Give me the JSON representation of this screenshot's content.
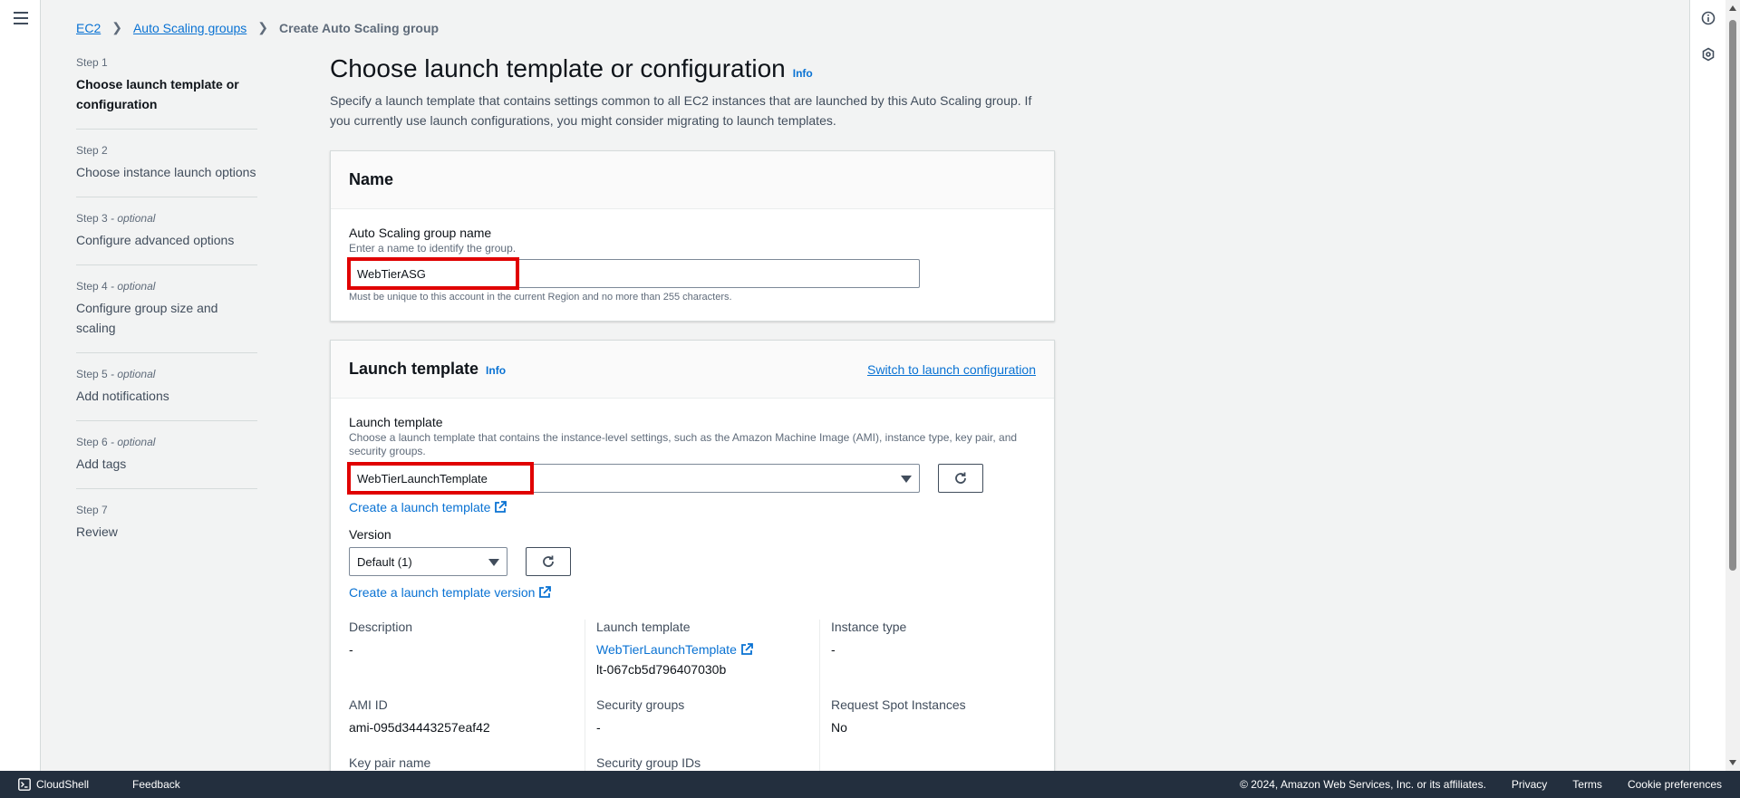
{
  "breadcrumb": {
    "items": [
      "EC2",
      "Auto Scaling groups"
    ],
    "current": "Create Auto Scaling group"
  },
  "steps": [
    {
      "num": "Step 1",
      "optional": "",
      "title": "Choose launch template or configuration"
    },
    {
      "num": "Step 2",
      "optional": "",
      "title": "Choose instance launch options"
    },
    {
      "num": "Step 3",
      "optional": " - optional",
      "title": "Configure advanced options"
    },
    {
      "num": "Step 4",
      "optional": " - optional",
      "title": "Configure group size and scaling"
    },
    {
      "num": "Step 5",
      "optional": " - optional",
      "title": "Add notifications"
    },
    {
      "num": "Step 6",
      "optional": " - optional",
      "title": "Add tags"
    },
    {
      "num": "Step 7",
      "optional": "",
      "title": "Review"
    }
  ],
  "main": {
    "title": "Choose launch template or configuration",
    "info": "Info",
    "description": "Specify a launch template that contains settings common to all EC2 instances that are launched by this Auto Scaling group. If you currently use launch configurations, you might consider migrating to launch templates."
  },
  "name_panel": {
    "header": "Name",
    "label": "Auto Scaling group name",
    "desc": "Enter a name to identify the group.",
    "value": "WebTierASG",
    "hint": "Must be unique to this account in the current Region and no more than 255 characters."
  },
  "launch_panel": {
    "header": "Launch template",
    "info": "Info",
    "switch_link": "Switch to launch configuration",
    "label": "Launch template",
    "desc": "Choose a launch template that contains the instance-level settings, such as the Amazon Machine Image (AMI), instance type, key pair, and security groups.",
    "selected": "WebTierLaunchTemplate",
    "create_link": "Create a launch template",
    "version_label": "Version",
    "version_selected": "Default (1)",
    "create_version_link": "Create a launch template version",
    "details": {
      "description_label": "Description",
      "description_value": "-",
      "template_label": "Launch template",
      "template_link": "WebTierLaunchTemplate",
      "template_id": "lt-067cb5d796407030b",
      "instance_type_label": "Instance type",
      "instance_type_value": "-",
      "ami_label": "AMI ID",
      "ami_value": "ami-095d34443257eaf42",
      "sg_label": "Security groups",
      "sg_value": "-",
      "spot_label": "Request Spot Instances",
      "spot_value": "No",
      "keypair_label": "Key pair name",
      "sg_ids_label": "Security group IDs"
    }
  },
  "footer": {
    "cloudshell": "CloudShell",
    "feedback": "Feedback",
    "copyright": "© 2024, Amazon Web Services, Inc. or its affiliates.",
    "privacy": "Privacy",
    "terms": "Terms",
    "cookies": "Cookie preferences"
  },
  "colors": {
    "link": "#0972d3",
    "highlight": "#e00000",
    "footer_bg": "#232f3e"
  }
}
